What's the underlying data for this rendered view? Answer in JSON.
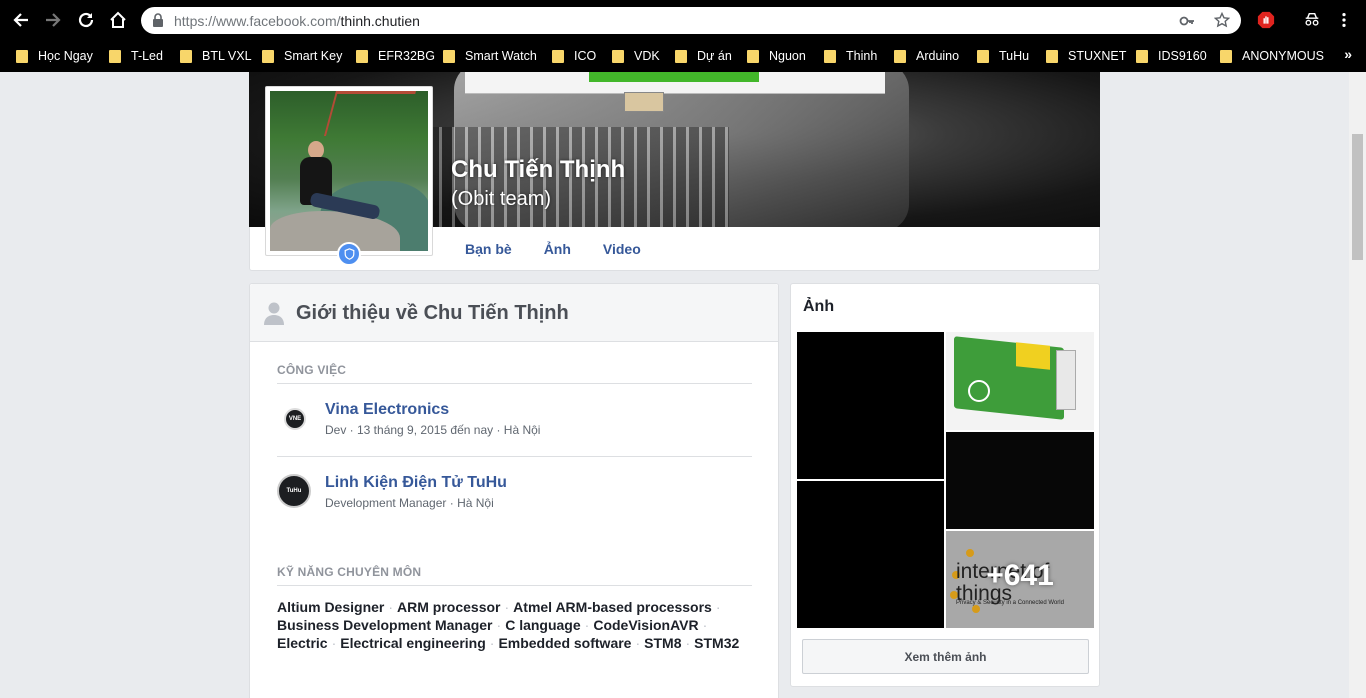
{
  "browser": {
    "url_host": "https://www.facebook.com/",
    "url_path": "thinh.chutien",
    "bookmarks": [
      "Học Ngay",
      "T-Led",
      "BTL VXL",
      "Smart Key",
      "EFR32BG",
      "Smart Watch",
      "ICO",
      "VDK",
      "Dự án",
      "Nguon",
      "Thinh",
      "Arduino",
      "TuHu",
      "STUXNET",
      "IDS9160",
      "ANONYMOUS"
    ],
    "bookmarks_overflow": "»"
  },
  "profile": {
    "name": "Chu Tiến Thịnh",
    "alternate_name": "(Obit team)",
    "tabs": [
      "Bạn bè",
      "Ảnh",
      "Video"
    ]
  },
  "intro": {
    "title": "Giới thiệu về Chu Tiến Thịnh",
    "work_label": "CÔNG VIỆC",
    "jobs": [
      {
        "company": "Vina Electronics",
        "details": "Dev · 13 tháng 9, 2015 đến nay · Hà Nội"
      },
      {
        "company": "Linh Kiện Điện Tử TuHu",
        "details": "Development Manager · Hà Nội",
        "logo_text": "TuHu"
      }
    ],
    "skills_label": "KỸ NĂNG CHUYÊN MÔN",
    "skills": [
      "Altium Designer",
      "ARM processor",
      "Atmel ARM-based processors",
      "Business Development Manager",
      "C language",
      "CodeVisionAVR",
      "Electric",
      "Electrical engineering",
      "Embedded software",
      "STM8",
      "STM32"
    ]
  },
  "photos": {
    "title": "Ảnh",
    "more_count": "+641",
    "iot_title": "internet of things",
    "iot_subtitle": "Privacy & Security in a Connected World",
    "see_more": "Xem thêm ảnh"
  },
  "colors": {
    "link_blue": "#365899",
    "page_bg": "#e9ebee",
    "bookmark_folder": "#f8d66a",
    "verified_badge": "#4e8ff0"
  }
}
